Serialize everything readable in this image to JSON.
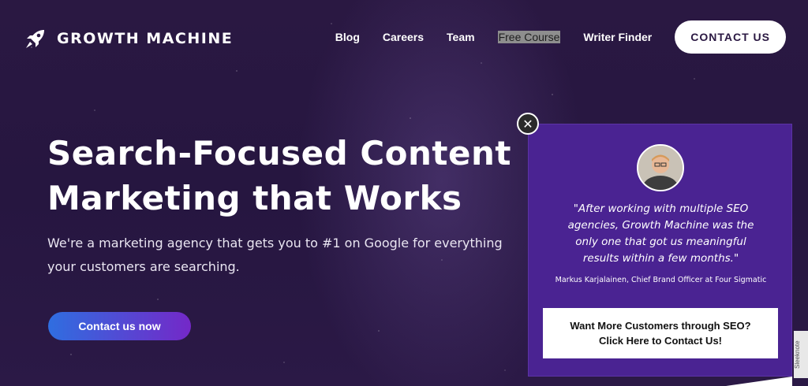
{
  "brand": {
    "name": "GROWTH MACHINE",
    "logo_icon": "rocket-icon"
  },
  "nav": {
    "items": [
      {
        "label": "Blog"
      },
      {
        "label": "Careers"
      },
      {
        "label": "Team"
      },
      {
        "label": "Free Course"
      },
      {
        "label": "Writer Finder"
      }
    ],
    "contact_label": "CONTACT US"
  },
  "hero": {
    "title_line1": "Search-Focused Content",
    "title_line2": "Marketing that Works",
    "subtitle_line1": "We're a marketing agency that gets you to #1 on Google for everything",
    "subtitle_line2": "your customers are searching.",
    "cta_label": "Contact us now"
  },
  "popup": {
    "close_icon": "close-icon",
    "quote_line1": "\"After working with multiple SEO",
    "quote_line2": "agencies, Growth Machine was the",
    "quote_line3": "only one that got us meaningful",
    "quote_line4": "results within a few months.\"",
    "author": "Markus Karjalainen, Chief Brand Officer at Four Sigmatic",
    "box_line1": "Want More Customers through SEO?",
    "box_line2": "Click Here to Contact Us!",
    "badge": "Sleeknote"
  },
  "colors": {
    "background": "#2a1842",
    "popup": "#4a2392",
    "cta_start": "#2f6ee0",
    "cta_end": "#7428c8"
  }
}
